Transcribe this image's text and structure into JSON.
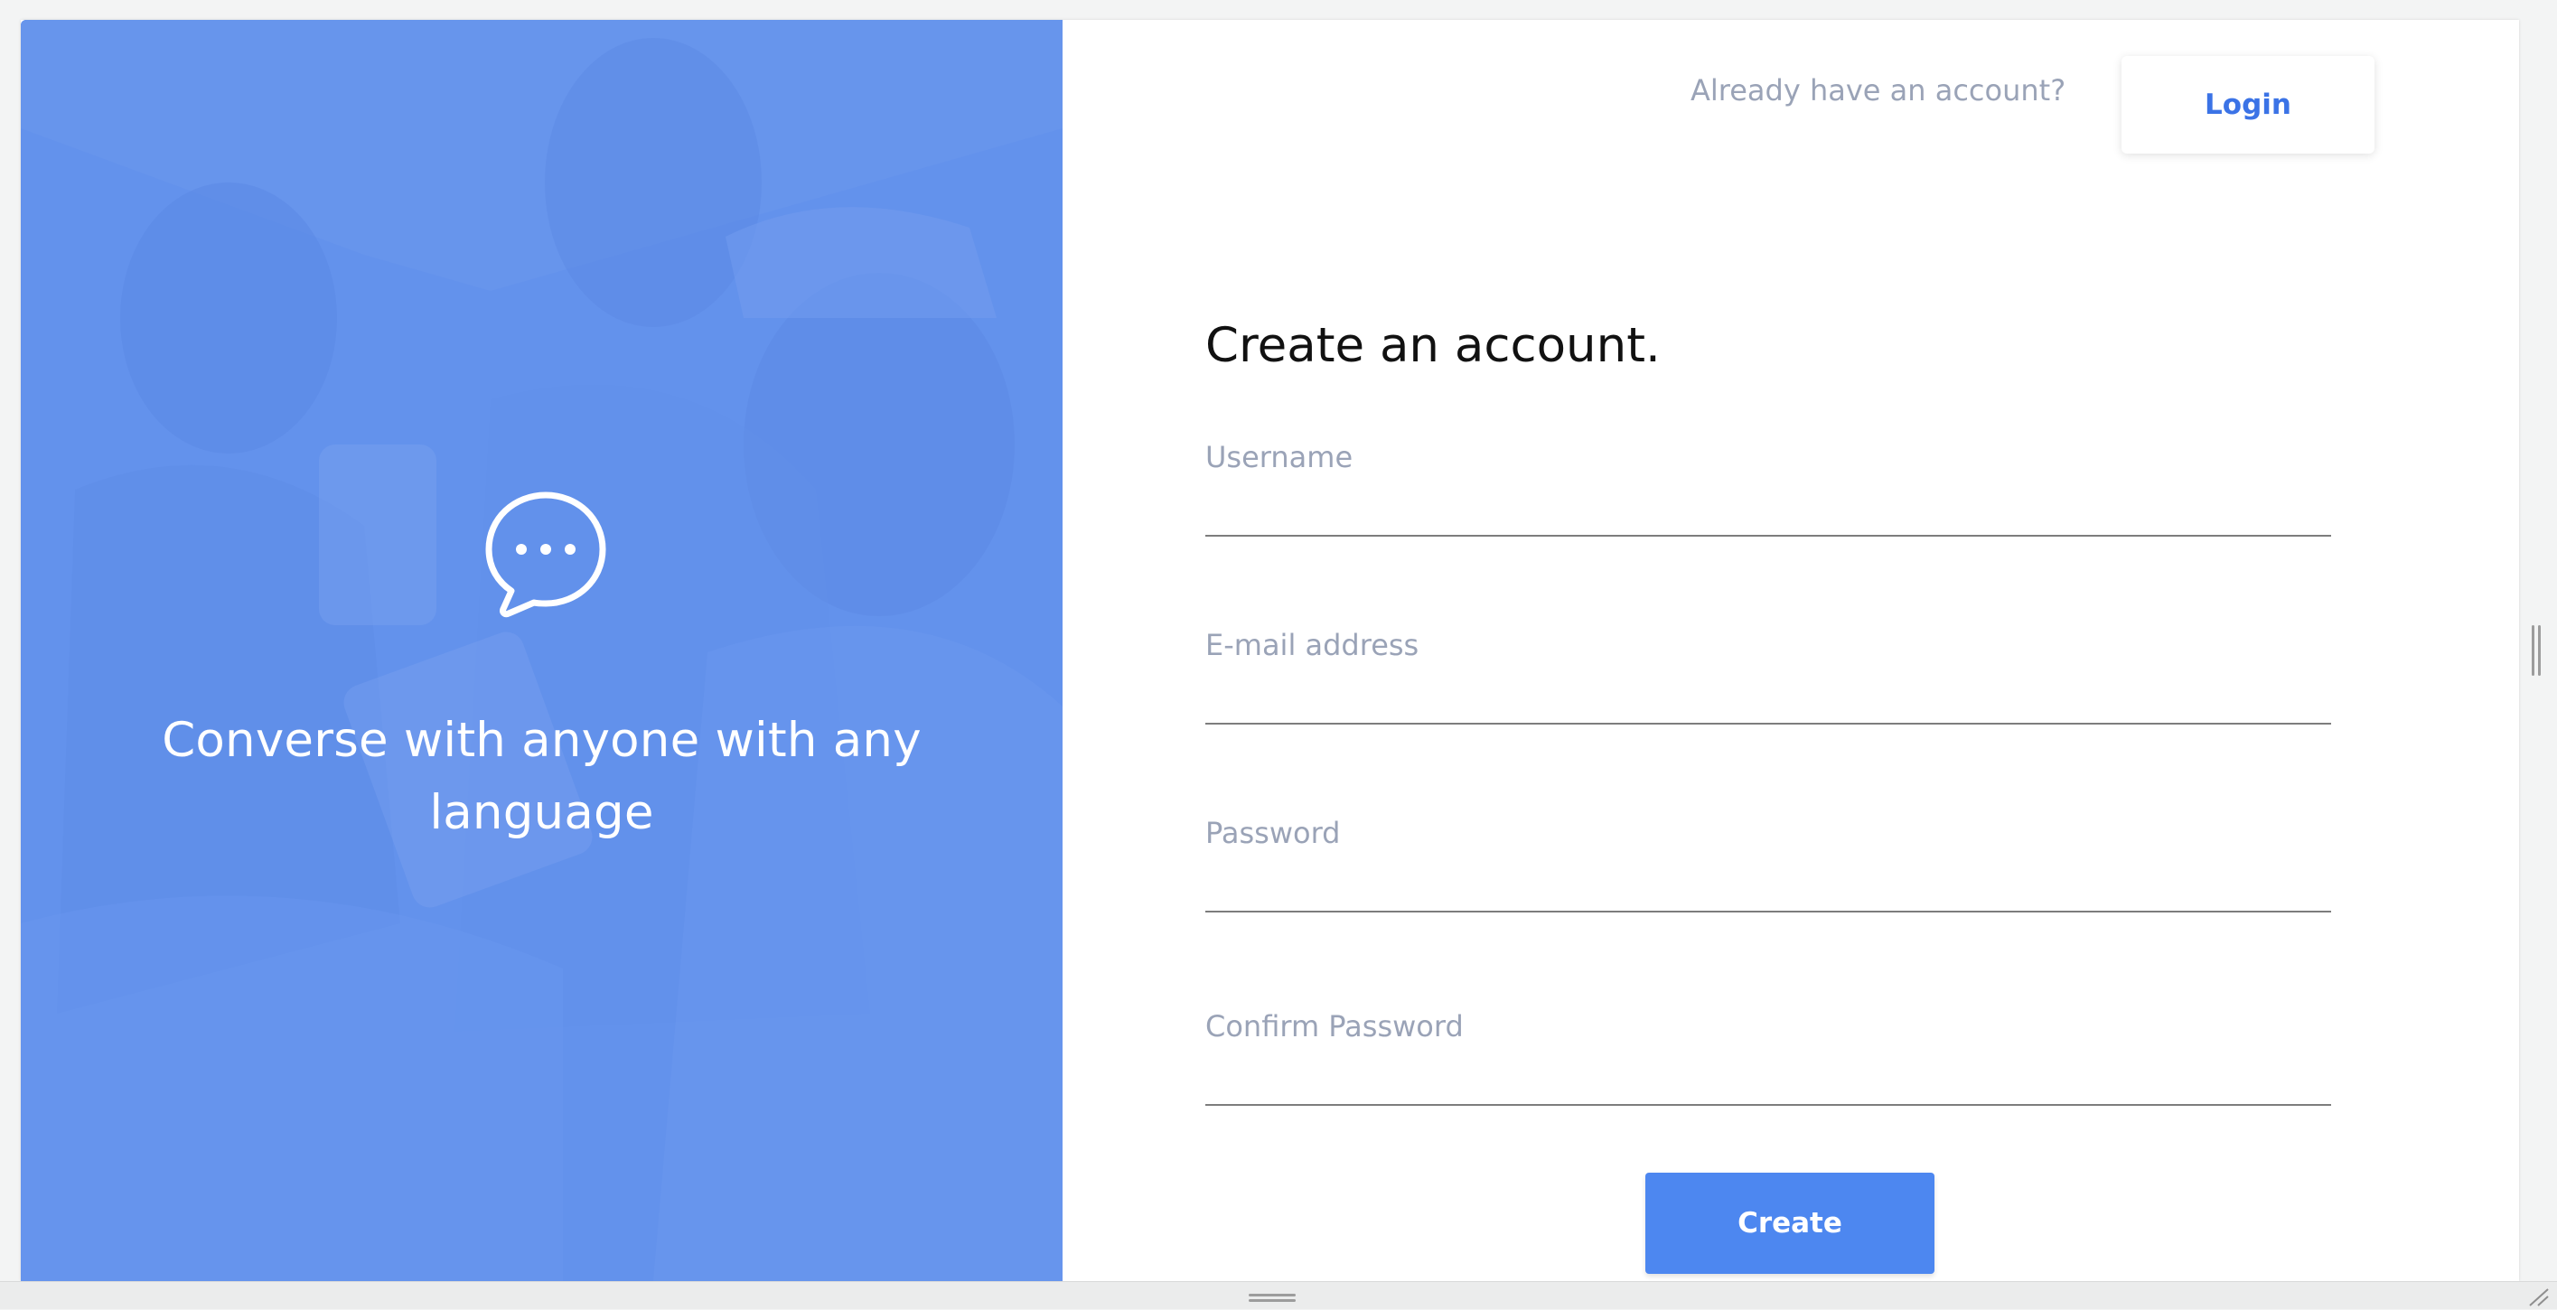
{
  "hero": {
    "icon": "chat-bubble-icon",
    "tagline": "Converse with anyone with any language"
  },
  "header": {
    "already_text": "Already have an account?",
    "login_label": "Login"
  },
  "form": {
    "title": "Create an account.",
    "fields": [
      {
        "label": "Username",
        "value": ""
      },
      {
        "label": "E-mail address",
        "value": ""
      },
      {
        "label": "Password",
        "value": ""
      },
      {
        "label": "Confirm Password",
        "value": ""
      }
    ],
    "submit_label": "Create"
  },
  "colors": {
    "accent": "#4d87f0",
    "link": "#3b73e6",
    "muted_text": "#9aa3b7",
    "hero_overlay": "#5c8eee"
  }
}
